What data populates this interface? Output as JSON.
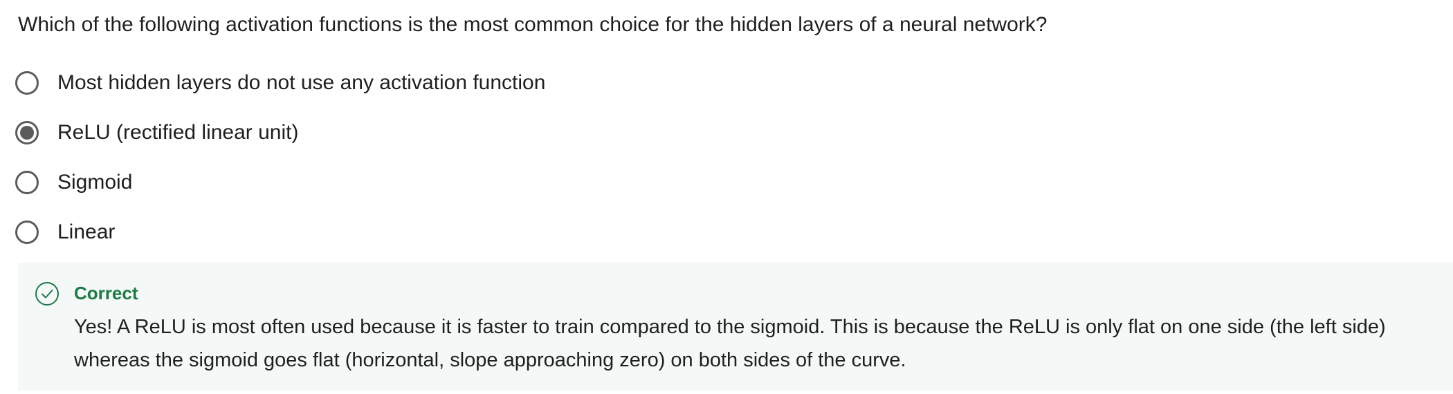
{
  "question": {
    "text": "Which of the following activation functions is the most common choice for the hidden layers of a neural network?"
  },
  "options": [
    {
      "label": "Most hidden layers do not use any activation function",
      "selected": false
    },
    {
      "label": "ReLU (rectified linear unit)",
      "selected": true
    },
    {
      "label": "Sigmoid",
      "selected": false
    },
    {
      "label": "Linear",
      "selected": false
    }
  ],
  "feedback": {
    "status": "Correct",
    "message": "Yes! A ReLU is most often used because it is faster to train compared to the sigmoid. This is because the ReLU is only flat on one side (the left side) whereas the sigmoid goes flat (horizontal, slope approaching zero) on both sides of the curve.",
    "icon": "check-circle-icon"
  },
  "colors": {
    "correct_green": "#1b7a45",
    "feedback_background": "#f4f8f6",
    "radio_gray": "#5b5b5b"
  }
}
